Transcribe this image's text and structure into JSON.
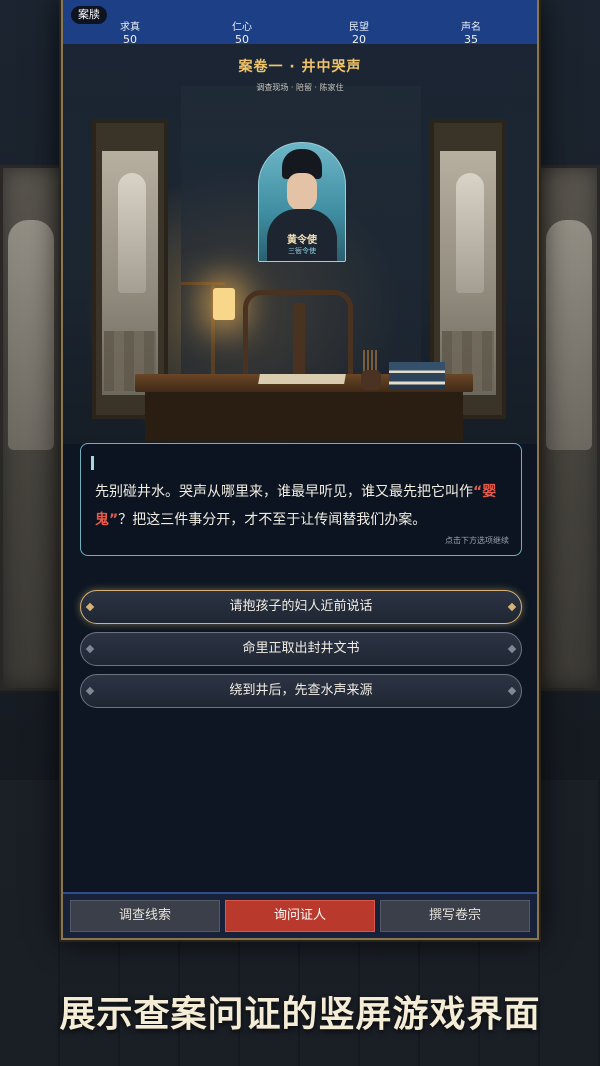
{
  "stats_bar": {
    "home_label": "案牍",
    "stats": [
      {
        "label": "求真",
        "value": "50"
      },
      {
        "label": "仁心",
        "value": "50"
      },
      {
        "label": "民望",
        "value": "20"
      },
      {
        "label": "声名",
        "value": "35"
      }
    ]
  },
  "case": {
    "title": "案卷一 · 井中哭声",
    "subtitle": "调查现场 · 陪留 · 陈家住"
  },
  "character": {
    "name": "黄令使",
    "role": "三衙令使"
  },
  "dialogue": {
    "text_part1": "先别碰井水。哭声从哪里来，谁最早听见，谁又最先把它叫作",
    "highlight": "“婴鬼”",
    "text_part2": "？把这三件事分开，才不至于让传闻替我们办案。",
    "hint": "点击下方选项继续"
  },
  "options": [
    {
      "label": "请抱孩子的妇人近前说话",
      "selected": true
    },
    {
      "label": "命里正取出封井文书",
      "selected": false
    },
    {
      "label": "绕到井后，先查水声来源",
      "selected": false
    }
  ],
  "tabs": [
    {
      "label": "调查线索",
      "active": false
    },
    {
      "label": "询问证人",
      "active": true
    },
    {
      "label": "撰写卷宗",
      "active": false
    }
  ],
  "caption": "展示查案问证的竖屏游戏界面",
  "colors": {
    "stats_bar": "#1d3f86",
    "accent_gold": "#f0c46a",
    "highlight_red": "#e35a4a",
    "active_tab": "#b93a2c"
  }
}
